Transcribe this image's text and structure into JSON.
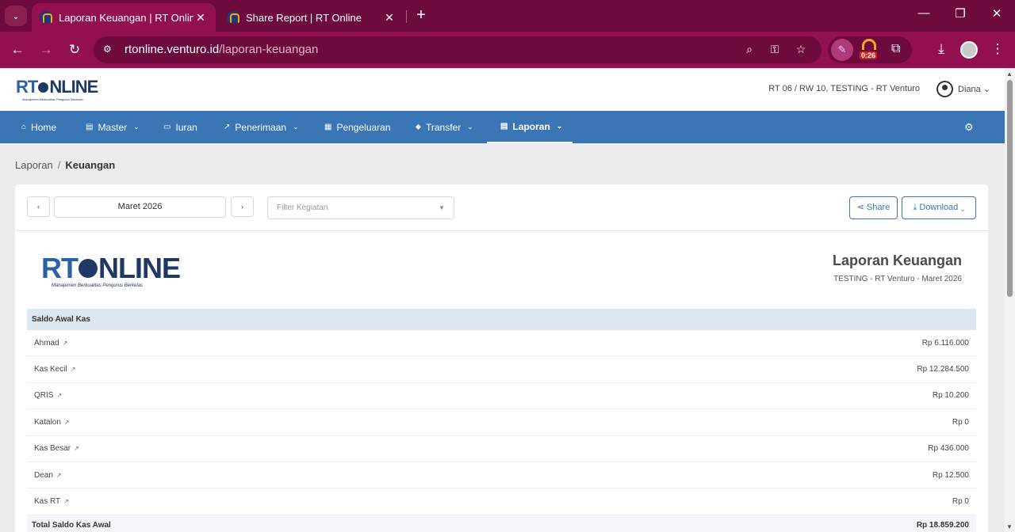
{
  "browser": {
    "tabs": [
      {
        "title": "Laporan Keuangan | RT Online",
        "close": "✕"
      },
      {
        "title": "Share Report | RT Online",
        "close": "✕"
      }
    ],
    "new_tab": "+",
    "url_domain": "rtonline.venturo.id",
    "url_path": "/laporan-keuangan",
    "timer_badge": "0:26"
  },
  "app": {
    "logo": {
      "rt": "RT",
      "online": "NLINE",
      "tagline": "Manajemen Berkualitas Pengurus Berkelas"
    },
    "rt_info": "RT 06 / RW 10, TESTING - RT Venturo",
    "user_name": "Diana",
    "user_chevron": "⌄",
    "nav": [
      {
        "label": "Home",
        "icon": "⌂"
      },
      {
        "label": "Master",
        "icon": "▤",
        "chevron": "⌄"
      },
      {
        "label": "Iuran",
        "icon": "▭"
      },
      {
        "label": "Penerimaan",
        "icon": "↗",
        "chevron": "⌄"
      },
      {
        "label": "Pengeluaran",
        "icon": "▦"
      },
      {
        "label": "Transfer",
        "icon": "⬥",
        "chevron": "⌄"
      },
      {
        "label": "Laporan",
        "icon": "▤",
        "chevron": "⌄"
      }
    ]
  },
  "breadcrumb": {
    "parent": "Laporan",
    "separator": "/",
    "current": "Keuangan"
  },
  "filters": {
    "prev": "‹",
    "next": "›",
    "month": "Maret 2026",
    "kegiatan_placeholder": "Filter Kegiatan",
    "share_label": "Share",
    "download_label": "Download"
  },
  "report": {
    "title": "Laporan Keuangan",
    "subtitle": "TESTING - RT Venturo - Maret 2026",
    "section_title": "Saldo Awal Kas",
    "rows": [
      {
        "name": "Ahmad",
        "amount": "Rp 6.116.000"
      },
      {
        "name": "Kas Kecil",
        "amount": "Rp 12.284.500"
      },
      {
        "name": "QRIS",
        "amount": "Rp 10.200"
      },
      {
        "name": "Katalon",
        "amount": "Rp 0"
      },
      {
        "name": "Kas Besar",
        "amount": "Rp 436.000"
      },
      {
        "name": "Dean",
        "amount": "Rp 12.500"
      },
      {
        "name": "Kas RT",
        "amount": "Rp 0"
      }
    ],
    "total_label": "Total Saldo Kas Awal",
    "total_amount": "Rp 18.859.200"
  }
}
